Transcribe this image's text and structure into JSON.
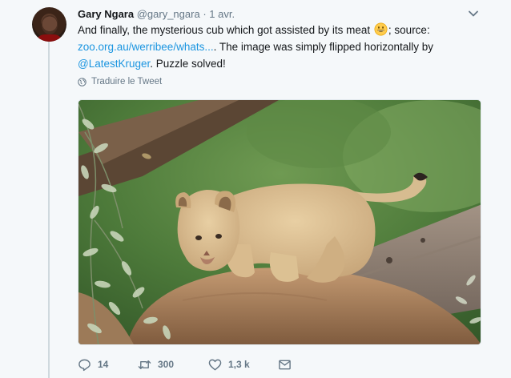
{
  "tweet": {
    "author_name": "Gary Ngara",
    "handle": "@gary_ngara",
    "separator": "·",
    "date": "1 avr.",
    "text_part1": "And finally, the mysterious cub which got assisted by its meat ",
    "text_part2": "; source:",
    "link_url_text": "zoo.org.au/werribee/whats...",
    "text_part3": ". The image was simply flipped horizontally by",
    "mention": "@LatestKruger",
    "text_part4": ". Puzzle solved!",
    "translate_label": "Traduire le Tweet"
  },
  "actions": {
    "reply_count": "14",
    "retweet_count": "300",
    "like_count": "1,3 k"
  },
  "colors": {
    "link": "#1b95e0",
    "muted": "#657786",
    "background": "#f5f8fa"
  },
  "icons": {
    "menu": "chevron-down-icon",
    "emoji": "grinning-face-emoji",
    "translate": "globe-icon",
    "reply": "reply-icon",
    "retweet": "retweet-icon",
    "like": "heart-icon",
    "message": "envelope-icon"
  }
}
